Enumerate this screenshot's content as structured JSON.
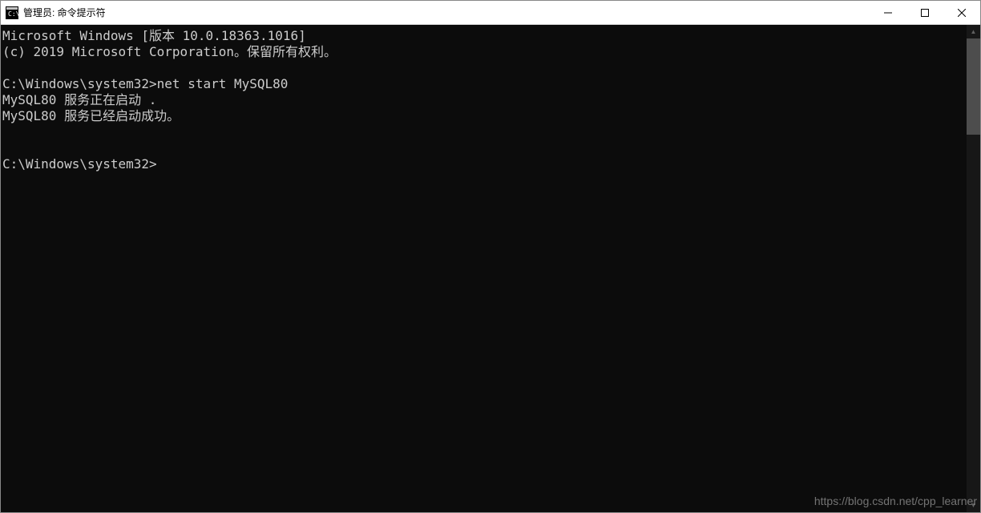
{
  "window": {
    "title": "管理员: 命令提示符"
  },
  "terminal": {
    "lines": [
      "Microsoft Windows [版本 10.0.18363.1016]",
      "(c) 2019 Microsoft Corporation。保留所有权利。",
      "",
      "C:\\Windows\\system32>net start MySQL80",
      "MySQL80 服务正在启动 .",
      "MySQL80 服务已经启动成功。",
      "",
      "",
      "C:\\Windows\\system32>"
    ]
  },
  "watermark": "https://blog.csdn.net/cpp_learner"
}
